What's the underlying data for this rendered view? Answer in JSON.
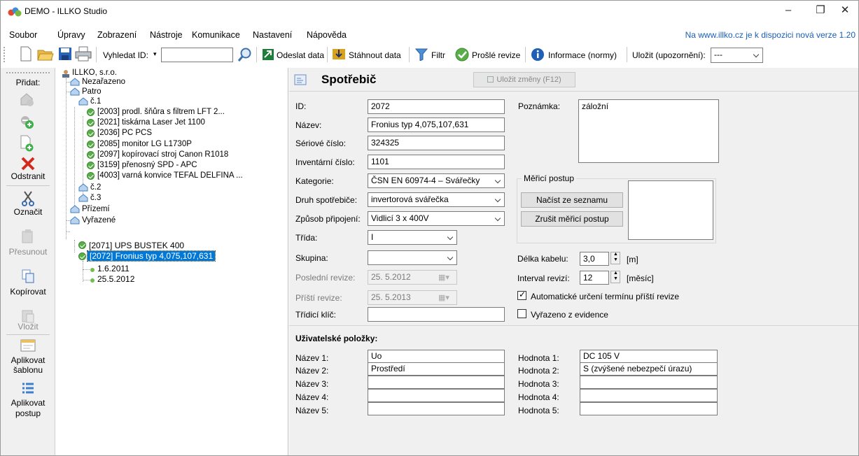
{
  "window": {
    "title": "DEMO - ILLKO Studio"
  },
  "menu": [
    "Soubor",
    "Úpravy",
    "Zobrazení",
    "Nástroje",
    "Komunikace",
    "Nastavení",
    "Nápověda"
  ],
  "update_notice": "Na www.illko.cz je k dispozici nová verze 1.20",
  "toolbar": {
    "search_label": "Vyhledat ID:",
    "search_value": "",
    "send": "Odeslat data",
    "download": "Stáhnout data",
    "filter": "Filtr",
    "expired": "Prošlé revize",
    "info": "Informace (normy)",
    "save_label": "Uložit (upozornění):",
    "save_value": "---"
  },
  "sidebar": {
    "header": "Přidat:",
    "remove": "Odstranit",
    "mark": "Označit",
    "move": "Přesunout",
    "copy": "Kopírovat",
    "paste": "Vložit",
    "apply_template_1": "Aplikovat",
    "apply_template_2": "šablonu",
    "apply_proc_1": "Aplikovat",
    "apply_proc_2": "postup"
  },
  "tree": {
    "root": "ILLKO, s.r.o.",
    "unassigned": "Nezařazeno",
    "floor": "Patro",
    "c1": "č.1",
    "items": [
      "[2003] prodl. šňůra s filtrem LFT 2...",
      "[2021] tiskárna Laser Jet 1100",
      "[2036] PC PCS",
      "[2085] monitor LG L1730P",
      "[2097] kopírovací stroj Canon R1018",
      "[3159] přenosný SPD - APC",
      "[4003] varná konvice TEFAL DELFINA ..."
    ],
    "c2": "č.2",
    "c3": "č.3",
    "ground": "Přízemí",
    "retired": "Vyřazené",
    "retired_items": [
      "[2071] UPS BUSTEK 400",
      "[2072] Fronius typ 4,075,107,631"
    ],
    "revisions": [
      "1.6.2011",
      "25.5.2012"
    ]
  },
  "form": {
    "title": "Spotřebič",
    "save_button": "Uložit změny (F12)",
    "id_label": "ID:",
    "id": "2072",
    "name_label": "Název:",
    "name": "Fronius typ 4,075,107,631",
    "serial_label": "Sériové číslo:",
    "serial": "324325",
    "inventory_label": "Inventární číslo:",
    "inventory": "1101",
    "category_label": "Kategorie:",
    "category": "ČSN EN 60974-4 – Svářečky",
    "type_label": "Druh spotřebiče:",
    "type": "invertorová svářečka",
    "connection_label": "Způsob připojení:",
    "connection": "Vidlicí 3 x 400V",
    "class_label": "Třída:",
    "class": "I",
    "group_label": "Skupina:",
    "group": "",
    "last_rev_label": "Poslední revize:",
    "last_rev": "25. 5.2012",
    "next_rev_label": "Příští revize:",
    "next_rev": "25. 5.2013",
    "sort_label": "Třídicí klíč:",
    "sort": "",
    "note_label": "Poznámka:",
    "note": "záložní",
    "proc_group": "Měřicí postup",
    "load_list": "Načíst ze seznamu",
    "cancel_proc": "Zrušit měřicí postup",
    "cable_label": "Délka kabelu:",
    "cable": "3,0",
    "cable_unit": "[m]",
    "interval_label": "Interval revizí:",
    "interval": "12",
    "interval_unit": "[měsíc]",
    "auto_label": "Automatické určení termínu příští revize",
    "auto_checked": true,
    "retired_label": "Vyřazeno z evidence",
    "retired_checked": false,
    "user_items": "Uživatelské položky:",
    "names": [
      {
        "label": "Název 1:",
        "value": "Uo"
      },
      {
        "label": "Název 2:",
        "value": "Prostředí"
      },
      {
        "label": "Název 3:",
        "value": ""
      },
      {
        "label": "Název 4:",
        "value": ""
      },
      {
        "label": "Název 5:",
        "value": ""
      }
    ],
    "values": [
      {
        "label": "Hodnota 1:",
        "value": "DC 105 V"
      },
      {
        "label": "Hodnota 2:",
        "value": "S (zvýšené nebezpečí úrazu)"
      },
      {
        "label": "Hodnota 3:",
        "value": ""
      },
      {
        "label": "Hodnota 4:",
        "value": ""
      },
      {
        "label": "Hodnota 5:",
        "value": ""
      }
    ]
  },
  "colors": {
    "selection": "#0078d7",
    "accent_green": "#5aae4a",
    "link": "#1a5fb4"
  }
}
